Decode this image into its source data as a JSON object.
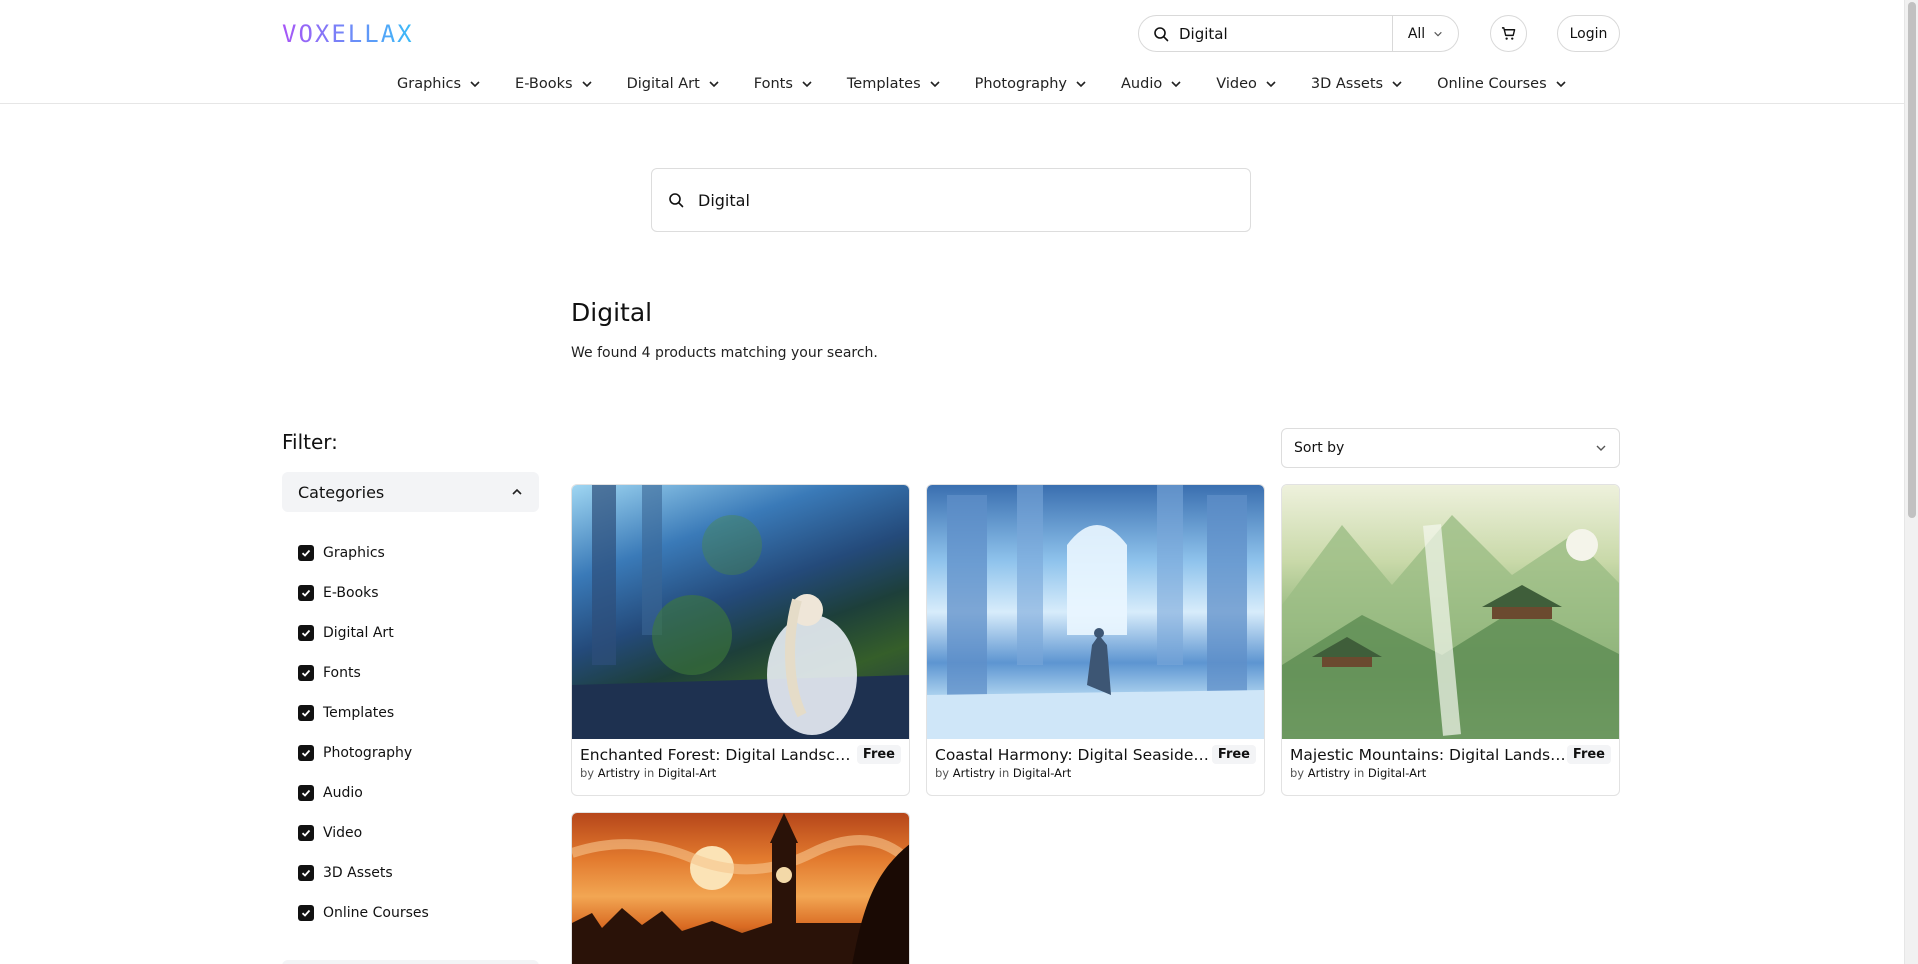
{
  "header": {
    "logo": "VOXELLAX",
    "search_value": "Digital",
    "search_scope": "All",
    "login_label": "Login"
  },
  "nav": [
    {
      "label": "Graphics"
    },
    {
      "label": "E-Books"
    },
    {
      "label": "Digital Art"
    },
    {
      "label": "Fonts"
    },
    {
      "label": "Templates"
    },
    {
      "label": "Photography"
    },
    {
      "label": "Audio"
    },
    {
      "label": "Video"
    },
    {
      "label": "3D Assets"
    },
    {
      "label": "Online Courses"
    }
  ],
  "main_search": {
    "value": "Digital"
  },
  "results": {
    "title": "Digital",
    "subtitle": "We found 4 products matching your search."
  },
  "filter": {
    "label": "Filter:",
    "categories_title": "Categories",
    "categories": [
      {
        "label": "Graphics",
        "checked": true
      },
      {
        "label": "E-Books",
        "checked": true
      },
      {
        "label": "Digital Art",
        "checked": true
      },
      {
        "label": "Fonts",
        "checked": true
      },
      {
        "label": "Templates",
        "checked": true
      },
      {
        "label": "Photography",
        "checked": true
      },
      {
        "label": "Audio",
        "checked": true
      },
      {
        "label": "Video",
        "checked": true
      },
      {
        "label": "3D Assets",
        "checked": true
      },
      {
        "label": "Online Courses",
        "checked": true
      }
    ]
  },
  "sort": {
    "label": "Sort by"
  },
  "products": [
    {
      "name": "Enchanted Forest: Digital Landscape…",
      "price": "Free",
      "by": "by",
      "author": "Artistry",
      "in": "in",
      "category": "Digital-Art"
    },
    {
      "name": "Coastal Harmony: Digital Seaside…",
      "price": "Free",
      "by": "by",
      "author": "Artistry",
      "in": "in",
      "category": "Digital-Art"
    },
    {
      "name": "Majestic Mountains: Digital Landsca…",
      "price": "Free",
      "by": "by",
      "author": "Artistry",
      "in": "in",
      "category": "Digital-Art"
    }
  ],
  "colors": {
    "logo_gradient_start": "#a855f7",
    "logo_gradient_end": "#38bdf8",
    "checkbox": "#111111"
  }
}
